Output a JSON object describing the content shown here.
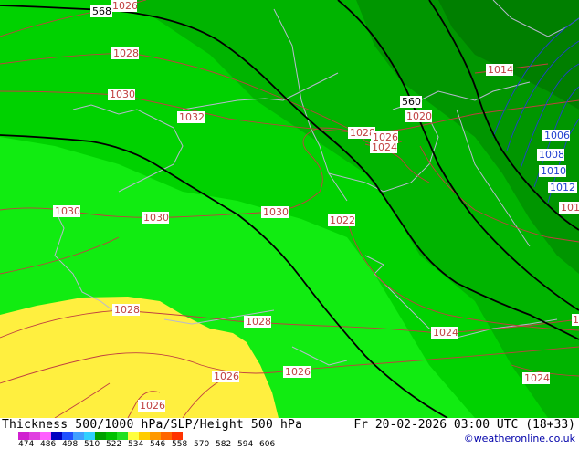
{
  "map": {
    "isobars_red": [
      {
        "text": "1026",
        "id": "iso-1026-top"
      },
      {
        "text": "1028",
        "id": "iso-1028-nw"
      },
      {
        "text": "1030",
        "id": "iso-1030-n"
      },
      {
        "text": "1032",
        "id": "iso-1032"
      },
      {
        "text": "1030",
        "id": "iso-1030-w"
      },
      {
        "text": "1030",
        "id": "iso-1030-mid"
      },
      {
        "text": "1030",
        "id": "iso-1030-c"
      },
      {
        "text": "1028",
        "id": "iso-1028-ne"
      },
      {
        "text": "1026",
        "id": "iso-1026-ne"
      },
      {
        "text": "1024",
        "id": "iso-1024-ne"
      },
      {
        "text": "1020",
        "id": "iso-1020"
      },
      {
        "text": "1014",
        "id": "iso-1014"
      },
      {
        "text": "1022",
        "id": "iso-1022"
      },
      {
        "text": "1028",
        "id": "iso-1028-sw"
      },
      {
        "text": "1028",
        "id": "iso-1028-s"
      },
      {
        "text": "1024",
        "id": "iso-1024-se"
      },
      {
        "text": "1026",
        "id": "iso-1026-s"
      },
      {
        "text": "1026",
        "id": "iso-1026-sw"
      },
      {
        "text": "1026",
        "id": "iso-1026-bl"
      },
      {
        "text": "1024",
        "id": "iso-1024-br"
      },
      {
        "text": "101",
        "id": "iso-101-e"
      },
      {
        "text": "1",
        "id": "iso-1-e"
      }
    ],
    "isobars_blue": [
      {
        "text": "1006",
        "id": "iso-1006"
      },
      {
        "text": "1008",
        "id": "iso-1008"
      },
      {
        "text": "1010",
        "id": "iso-1010"
      },
      {
        "text": "1012",
        "id": "iso-1012"
      }
    ],
    "heights_black": [
      {
        "text": "568",
        "id": "z-568"
      },
      {
        "text": "560",
        "id": "z-560"
      }
    ],
    "colors": {
      "yellow": "#ffef3f",
      "green_light": "#11ec11",
      "green_mid": "#00d200",
      "green_dark": "#00b400",
      "green_darker": "#009600",
      "isobar_red": "#c04040",
      "isobar_blue": "#2040d0",
      "border": "#b8b8d0"
    }
  },
  "footer": {
    "title": "Thickness 500/1000 hPa/SLP/Height 500 hPa",
    "datetime": "Fr 20-02-2026 03:00 UTC (18+33)",
    "copyright": "©weatheronline.co.uk",
    "scale_ticks": [
      "474",
      "486",
      "498",
      "510",
      "522",
      "534",
      "546",
      "558",
      "570",
      "582",
      "594",
      "606"
    ],
    "scale_colors": [
      "#d020d0",
      "#e040e0",
      "#ff60ff",
      "#0000c0",
      "#2050ff",
      "#40a0ff",
      "#30d0ff",
      "#00a000",
      "#00c000",
      "#20e020",
      "#ffff40",
      "#ffcc00",
      "#ff9900",
      "#ff6600",
      "#ff3300"
    ]
  }
}
